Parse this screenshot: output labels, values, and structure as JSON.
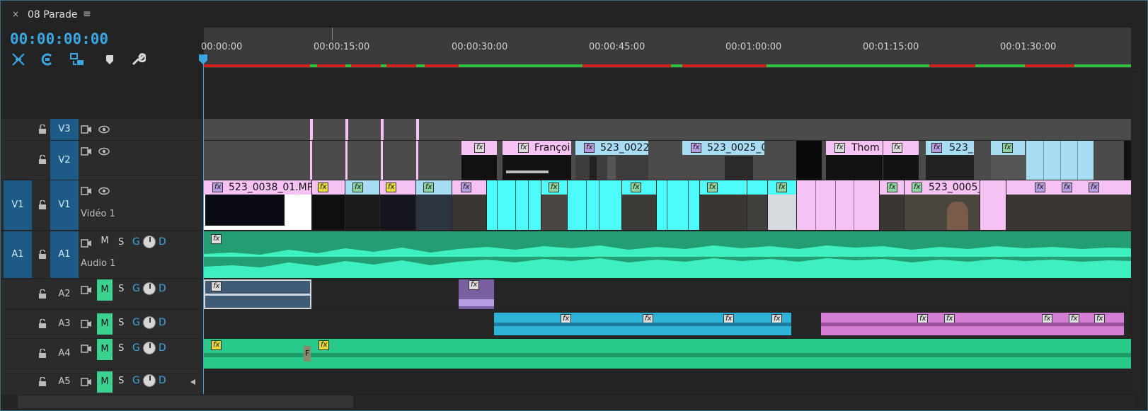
{
  "sequence": {
    "close_glyph": "×",
    "title": "08 Parade",
    "menu_glyph": "≡"
  },
  "timecode": "00:00:00:00",
  "tools": [
    {
      "name": "snap-icon"
    },
    {
      "name": "linked-selection-icon"
    },
    {
      "name": "insert-overwrite-icon"
    },
    {
      "name": "add-marker-icon"
    },
    {
      "name": "wrench-icon"
    }
  ],
  "ruler": {
    "labels": [
      "00:00:00",
      "00:00:15:00",
      "00:00:30:00",
      "00:00:45:00",
      "00:01:00:00",
      "00:01:15:00",
      "00:01:30:00"
    ]
  },
  "tracks": {
    "v3": {
      "name": "V3"
    },
    "v2": {
      "name": "V2"
    },
    "v1": {
      "source": "V1",
      "name": "V1",
      "label": "Vidéo 1"
    },
    "a1": {
      "source": "A1",
      "name": "A1",
      "label": "Audio 1",
      "mute": "M",
      "solo": "S",
      "g": "G",
      "d": "D"
    },
    "a2": {
      "name": "A2",
      "mute": "M",
      "solo": "S",
      "g": "G",
      "d": "D"
    },
    "a3": {
      "name": "A3",
      "mute": "M",
      "solo": "S",
      "g": "G",
      "d": "D"
    },
    "a4": {
      "name": "A4",
      "mute": "M",
      "solo": "S",
      "g": "G",
      "d": "D"
    },
    "a5": {
      "name": "A5",
      "mute": "M",
      "solo": "S",
      "g": "G",
      "d": "D"
    }
  },
  "clips": {
    "fx": "fx",
    "v1_first": "523_0038_01.MP4",
    "v1_late": "523_0005_",
    "v2_francois": "Françoi",
    "v2_0022": "523_0022_",
    "v2_0025": "523_0025_0",
    "v2_thom": "Thom",
    "v2_523": "523_",
    "a4_marker": "F"
  },
  "colors": {
    "accent": "#3aa7e3",
    "cyan_clip": "#4dfbfb",
    "pink_clip": "#f5c2f3",
    "light_blue_clip": "#a8dcf2",
    "audio_green": "#239e73",
    "audio_wave": "#3ef0c0",
    "a3_blue": "#2fb3d8",
    "a3_pink": "#d57fd4",
    "mute_on": "#3bd18e"
  }
}
